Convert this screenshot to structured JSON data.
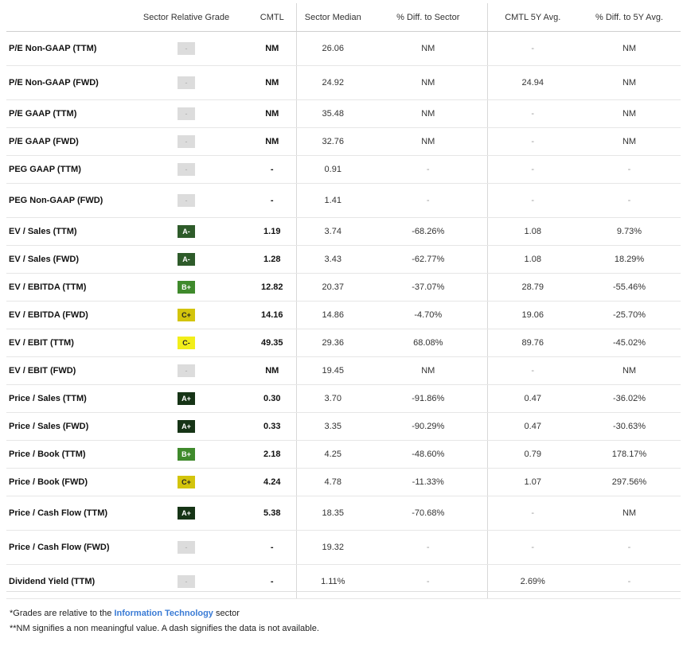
{
  "columns": [
    "",
    "Sector Relative Grade",
    "CMTL",
    "Sector Median",
    "% Diff. to Sector",
    "CMTL 5Y Avg.",
    "% Diff. to 5Y Avg."
  ],
  "rows": [
    {
      "metric": "P/E Non-GAAP (TTM)",
      "grade": "-",
      "grade_class": "none",
      "cmtl": "NM",
      "median": "26.06",
      "diff_sector": "NM",
      "avg5y": "-",
      "diff_5y": "NM",
      "tall": true
    },
    {
      "metric": "P/E Non-GAAP (FWD)",
      "grade": "-",
      "grade_class": "none",
      "cmtl": "NM",
      "median": "24.92",
      "diff_sector": "NM",
      "avg5y": "24.94",
      "diff_5y": "NM",
      "tall": true
    },
    {
      "metric": "P/E GAAP (TTM)",
      "grade": "-",
      "grade_class": "none",
      "cmtl": "NM",
      "median": "35.48",
      "diff_sector": "NM",
      "avg5y": "-",
      "diff_5y": "NM",
      "tall": false
    },
    {
      "metric": "P/E GAAP (FWD)",
      "grade": "-",
      "grade_class": "none",
      "cmtl": "NM",
      "median": "32.76",
      "diff_sector": "NM",
      "avg5y": "-",
      "diff_5y": "NM",
      "tall": false
    },
    {
      "metric": "PEG GAAP (TTM)",
      "grade": "-",
      "grade_class": "none",
      "cmtl": "-",
      "median": "0.91",
      "diff_sector": "-",
      "avg5y": "-",
      "diff_5y": "-",
      "tall": false
    },
    {
      "metric": "PEG Non-GAAP (FWD)",
      "grade": "-",
      "grade_class": "none",
      "cmtl": "-",
      "median": "1.41",
      "diff_sector": "-",
      "avg5y": "-",
      "diff_5y": "-",
      "tall": true
    },
    {
      "metric": "EV / Sales (TTM)",
      "grade": "A-",
      "grade_class": "a",
      "cmtl": "1.19",
      "median": "3.74",
      "diff_sector": "-68.26%",
      "avg5y": "1.08",
      "diff_5y": "9.73%",
      "tall": false
    },
    {
      "metric": "EV / Sales (FWD)",
      "grade": "A-",
      "grade_class": "a",
      "cmtl": "1.28",
      "median": "3.43",
      "diff_sector": "-62.77%",
      "avg5y": "1.08",
      "diff_5y": "18.29%",
      "tall": false
    },
    {
      "metric": "EV / EBITDA (TTM)",
      "grade": "B+",
      "grade_class": "b",
      "cmtl": "12.82",
      "median": "20.37",
      "diff_sector": "-37.07%",
      "avg5y": "28.79",
      "diff_5y": "-55.46%",
      "tall": false
    },
    {
      "metric": "EV / EBITDA (FWD)",
      "grade": "C+",
      "grade_class": "cplus",
      "cmtl": "14.16",
      "median": "14.86",
      "diff_sector": "-4.70%",
      "avg5y": "19.06",
      "diff_5y": "-25.70%",
      "tall": false
    },
    {
      "metric": "EV / EBIT (TTM)",
      "grade": "C-",
      "grade_class": "c",
      "cmtl": "49.35",
      "median": "29.36",
      "diff_sector": "68.08%",
      "avg5y": "89.76",
      "diff_5y": "-45.02%",
      "tall": false
    },
    {
      "metric": "EV / EBIT (FWD)",
      "grade": "-",
      "grade_class": "none",
      "cmtl": "NM",
      "median": "19.45",
      "diff_sector": "NM",
      "avg5y": "-",
      "diff_5y": "NM",
      "tall": false
    },
    {
      "metric": "Price / Sales (TTM)",
      "grade": "A+",
      "grade_class": "aplus",
      "cmtl": "0.30",
      "median": "3.70",
      "diff_sector": "-91.86%",
      "avg5y": "0.47",
      "diff_5y": "-36.02%",
      "tall": false
    },
    {
      "metric": "Price / Sales (FWD)",
      "grade": "A+",
      "grade_class": "aplus",
      "cmtl": "0.33",
      "median": "3.35",
      "diff_sector": "-90.29%",
      "avg5y": "0.47",
      "diff_5y": "-30.63%",
      "tall": false
    },
    {
      "metric": "Price / Book (TTM)",
      "grade": "B+",
      "grade_class": "b",
      "cmtl": "2.18",
      "median": "4.25",
      "diff_sector": "-48.60%",
      "avg5y": "0.79",
      "diff_5y": "178.17%",
      "tall": false
    },
    {
      "metric": "Price / Book (FWD)",
      "grade": "C+",
      "grade_class": "cplus",
      "cmtl": "4.24",
      "median": "4.78",
      "diff_sector": "-11.33%",
      "avg5y": "1.07",
      "diff_5y": "297.56%",
      "tall": false
    },
    {
      "metric": "Price / Cash Flow (TTM)",
      "grade": "A+",
      "grade_class": "aplus",
      "cmtl": "5.38",
      "median": "18.35",
      "diff_sector": "-70.68%",
      "avg5y": "-",
      "diff_5y": "NM",
      "tall": true
    },
    {
      "metric": "Price / Cash Flow (FWD)",
      "grade": "-",
      "grade_class": "none",
      "cmtl": "-",
      "median": "19.32",
      "diff_sector": "-",
      "avg5y": "-",
      "diff_5y": "-",
      "tall": true
    },
    {
      "metric": "Dividend Yield (TTM)",
      "grade": "-",
      "grade_class": "none",
      "cmtl": "-",
      "median": "1.11%",
      "diff_sector": "-",
      "avg5y": "2.69%",
      "diff_5y": "-",
      "tall": true
    }
  ],
  "footnotes": {
    "grades_prefix": "*Grades are relative to the ",
    "grades_link": "Information Technology",
    "grades_suffix": " sector",
    "nm_note": "**NM signifies a non meaningful value. A dash signifies the data is not available."
  }
}
